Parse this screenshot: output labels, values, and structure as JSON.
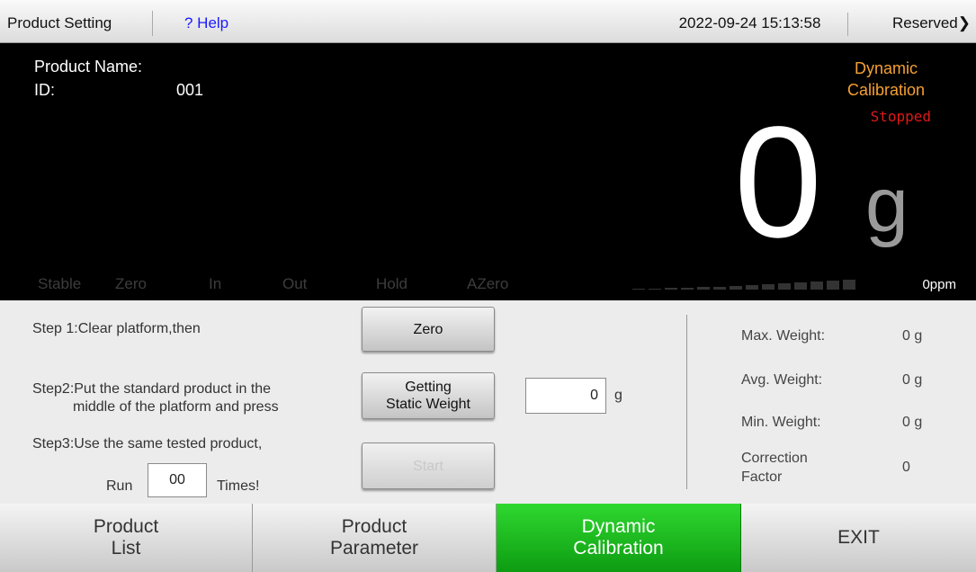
{
  "topbar": {
    "title": "Product Setting",
    "help": "? Help",
    "datetime": "2022-09-24 15:13:58",
    "reserved": "Reserved"
  },
  "display": {
    "product_name_label": "Product Name:",
    "id_label": "ID:",
    "id_value": "001",
    "mode_label": "Dynamic\nCalibration",
    "mode_status": "Stopped",
    "weight_value": "0",
    "weight_unit": "g",
    "indicators": [
      "Stable",
      "Zero",
      "In",
      "Out",
      "Hold",
      "AZero"
    ],
    "ppm": "0ppm",
    "bargraph_level": 0,
    "colors": {
      "mode_label": "#f5a032",
      "status": "#e01818",
      "indicator_off": "#3d3d3d"
    }
  },
  "calibration": {
    "step1": "Step 1:Clear platform,then",
    "step2_line1": "Step2:Put the standard product in the",
    "step2_line2": "middle of the platform and press",
    "step3": "Step3:Use the same tested product,",
    "run_label": "Run",
    "run_value": "00",
    "times_label": "Times!",
    "zero_button": "Zero",
    "static_weight_button_line1": "Getting",
    "static_weight_button_line2": "Static Weight",
    "static_weight_value": "0",
    "static_weight_unit": "g",
    "start_button": "Start"
  },
  "stats": {
    "max_label": "Max. Weight:",
    "max_value": "0 g",
    "avg_label": "Avg. Weight:",
    "avg_value": "0 g",
    "min_label": "Min. Weight:",
    "min_value": "0 g",
    "cf_label_line1": "Correction",
    "cf_label_line2": "Factor",
    "cf_value": "0"
  },
  "nav": {
    "product_list": "Product\nList",
    "product_parameter": "Product\nParameter",
    "dynamic_calibration": "Dynamic\nCalibration",
    "exit": "EXIT",
    "active_color": "#1fbf22"
  }
}
